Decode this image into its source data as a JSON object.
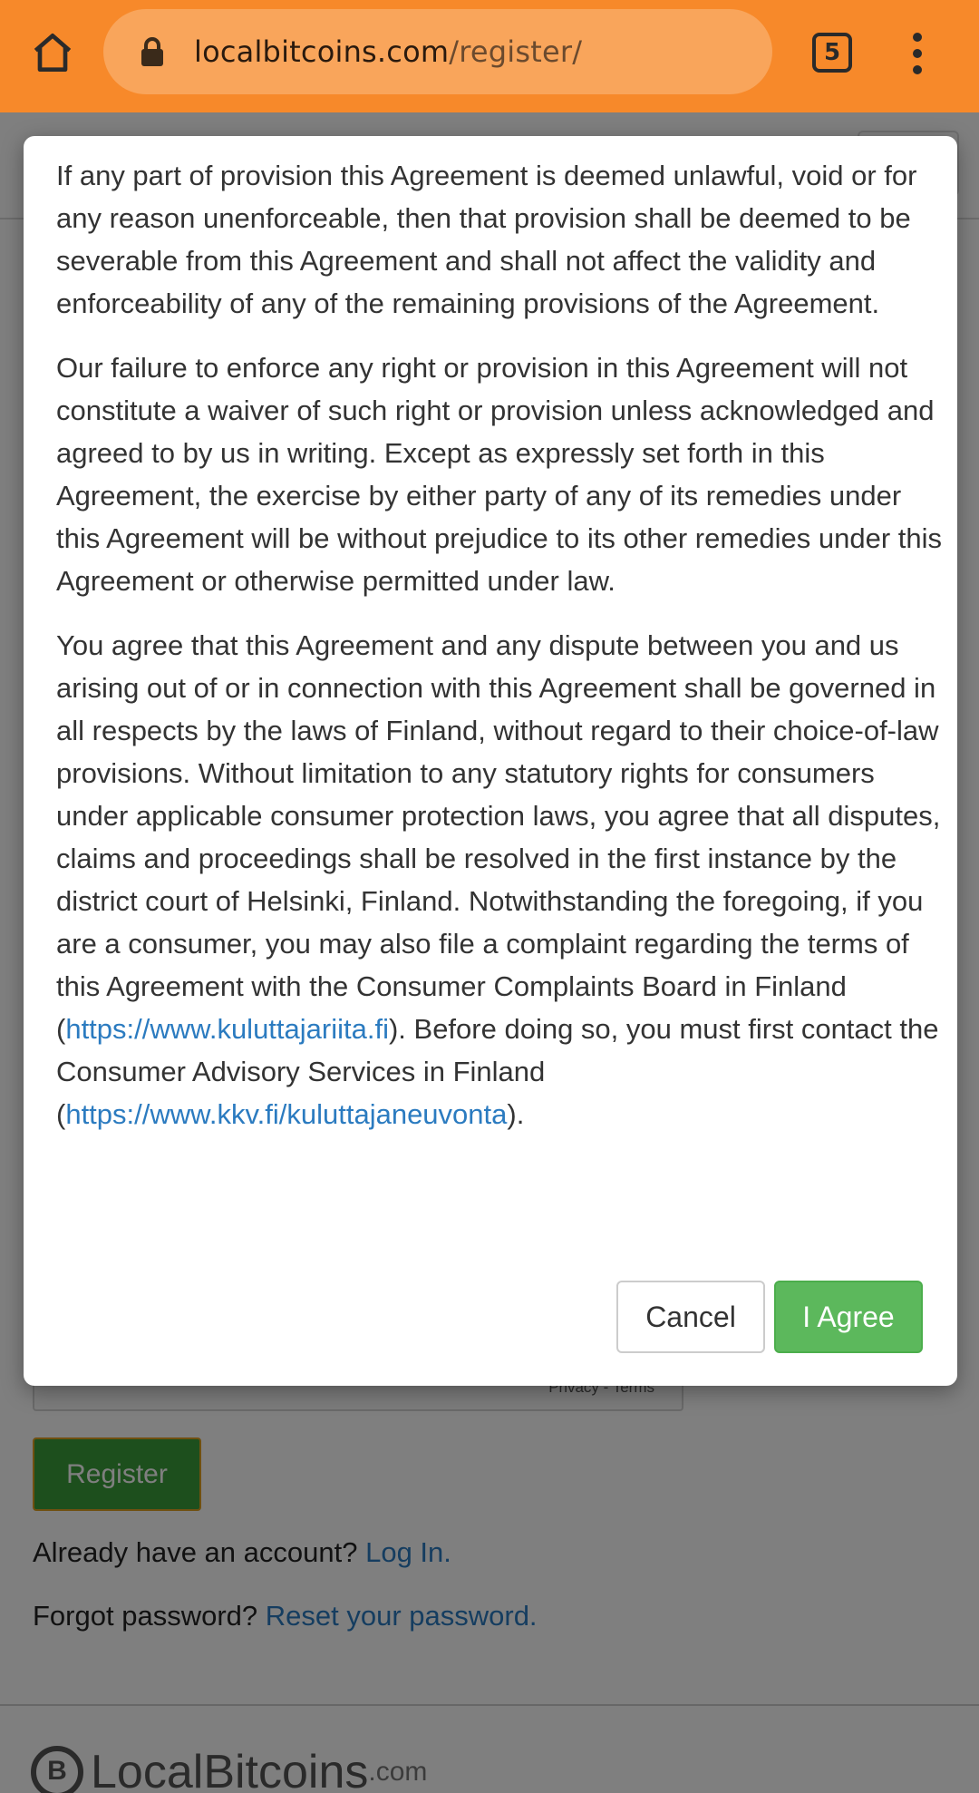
{
  "browser": {
    "url_host": "localbitcoins.com",
    "url_path": "/register/",
    "tab_count": "5",
    "toolbar_color": "#f7892a"
  },
  "page": {
    "captcha_links": "Privacy - Terms",
    "register_label": "Register",
    "login_prompt": "Already have an account?",
    "login_link": "Log In.",
    "forgot_prompt": "Forgot password?",
    "reset_link": "Reset your password.",
    "footer_logo_name": "LocalBitcoins",
    "footer_logo_suffix": ".com"
  },
  "modal": {
    "paragraph_1": "If any part of provision this Agreement is deemed unlawful, void or for any reason unenforceable, then that provision shall be deemed to be severable from this Agreement and shall not affect the validity and enforceability of any of the remaining provisions of the Agreement.",
    "paragraph_2": "Our failure to enforce any right or provision in this Agreement will not constitute a waiver of such right or provision unless acknowledged and agreed to by us in writing. Except as expressly set forth in this Agreement, the exercise by either party of any of its remedies under this Agreement will be without prejudice to its other remedies under this Agreement or otherwise permitted under law.",
    "paragraph_3_part1": "You agree that this Agreement and any dispute between you and us arising out of or in connection with this Agreement shall be governed in all respects by the laws of Finland, without regard to their choice-of-law provisions. Without limitation to any statutory rights for consumers under applicable consumer protection laws, you agree that all disputes, claims and proceedings shall be resolved in the first instance by the district court of Helsinki, Finland. Notwithstanding the foregoing, if you are a consumer, you may also file a complaint regarding the terms of this Agreement with the Consumer Complaints Board in Finland (",
    "link_1": "https://www.kuluttajariita.fi",
    "paragraph_3_part2": "). Before doing so, you must first contact the Consumer Advisory Services in Finland (",
    "link_2": "https://www.kkv.fi/kuluttajaneuvonta",
    "paragraph_3_part3": ").",
    "cancel_label": "Cancel",
    "agree_label": "I Agree",
    "agree_color": "#5cb85c",
    "link_color": "#2b7bc0"
  }
}
